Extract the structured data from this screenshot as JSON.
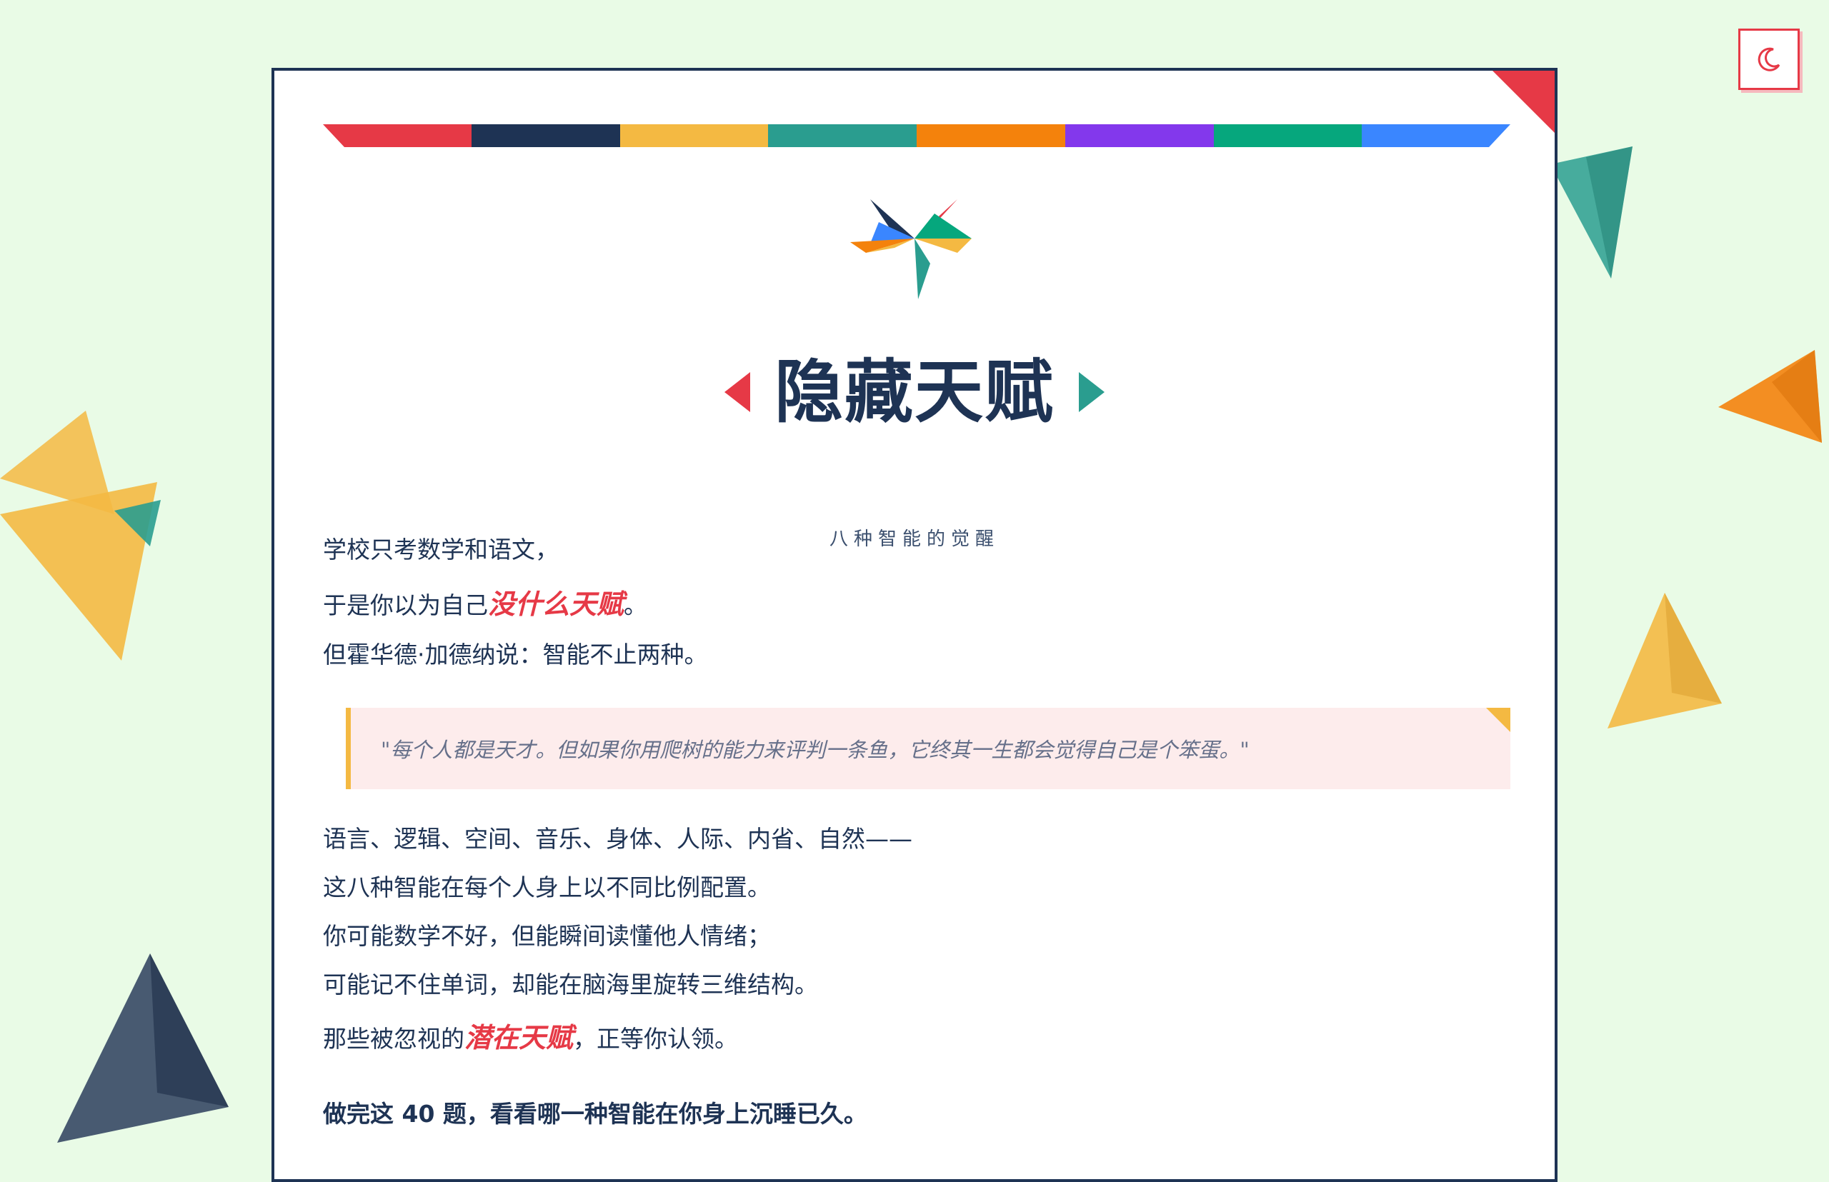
{
  "page": {
    "title": "隐藏天赋",
    "subtitle": "八种智能的觉醒"
  },
  "theme_toggle": {
    "icon": "moon-icon"
  },
  "intro": {
    "line1": "学校只考数学和语文，",
    "line2_prefix": "于是你以为自己",
    "line2_highlight": "没什么天赋",
    "line2_suffix": "。",
    "line3": "但霍华德·加德纳说：智能不止两种。"
  },
  "quote": {
    "text": "\"每个人都是天才。但如果你用爬树的能力来评判一条鱼，它终其一生都会觉得自己是个笨蛋。\""
  },
  "body": {
    "line1": "语言、逻辑、空间、音乐、身体、人际、内省、自然——",
    "line2": "这八种智能在每个人身上以不同比例配置。",
    "line3": "你可能数学不好，但能瞬间读懂他人情绪；",
    "line4": "可能记不住单词，却能在脑海里旋转三维结构。",
    "line5_prefix": "那些被忽视的",
    "line5_highlight": "潜在天赋",
    "line5_suffix": "，正等你认领。"
  },
  "cta": {
    "text": "做完这 40 题，看看哪一种智能在你身上沉睡已久。"
  },
  "colors": {
    "accent_red": "#e63946",
    "navy": "#1e3354",
    "yellow": "#f4b942",
    "teal": "#2a9d8f",
    "orange": "#f4820c",
    "purple": "#8338ec",
    "green": "#06a77d",
    "blue": "#3a86ff",
    "background": "#e9fbe6"
  }
}
